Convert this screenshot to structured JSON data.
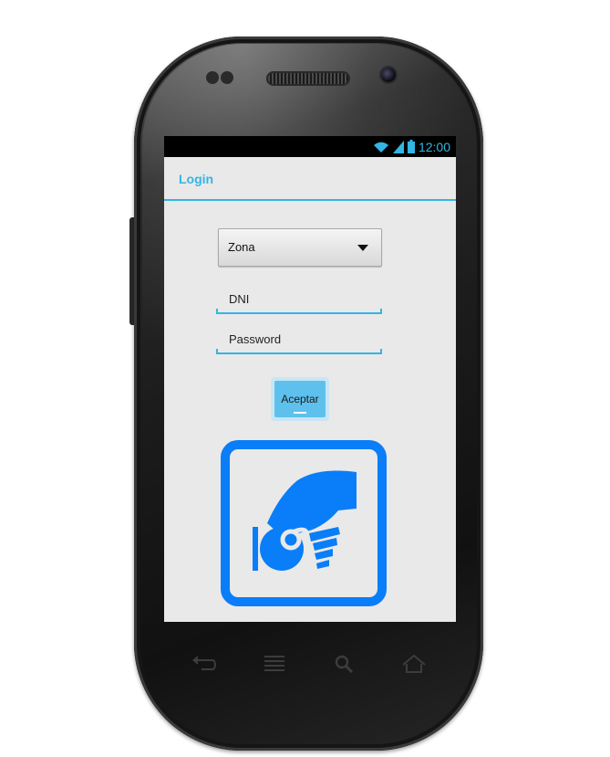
{
  "status_bar": {
    "time": "12:00"
  },
  "action_bar": {
    "title": "Login"
  },
  "form": {
    "zona_spinner": {
      "selected": "Zona"
    },
    "dni_field": {
      "hint": "DNI"
    },
    "password_field": {
      "hint": "Password"
    },
    "accept_button": {
      "label": "Aceptar"
    }
  },
  "logo": {
    "icon": "hand-holding-coin-icon"
  },
  "nav_buttons": [
    "back-icon",
    "menu-icon",
    "search-icon",
    "home-icon"
  ],
  "colors": {
    "accent": "#33b5e5",
    "logo_blue": "#0a7df8",
    "screen_bg": "#e9e9e9"
  }
}
